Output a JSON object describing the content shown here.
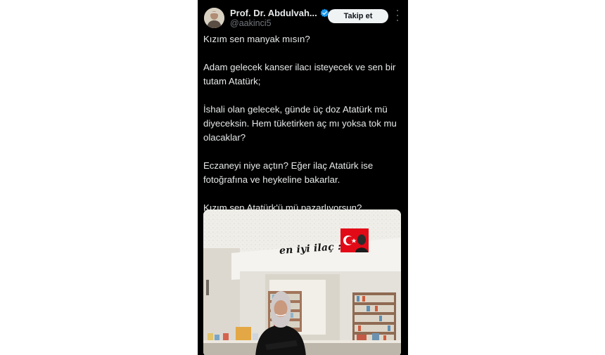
{
  "author": {
    "display_name": "Prof. Dr. Abdulvah...",
    "handle": "@aakinci5",
    "verified_icon": "verified-badge-icon",
    "avatar_icon": "profile-avatar"
  },
  "actions": {
    "follow_label": "Takip et",
    "more_icon": "more-options-icon"
  },
  "tweet": {
    "paragraphs": [
      "Kızım sen manyak mısın?",
      "Adam gelecek kanser ilacı isteyecek ve sen bir tutam Atatürk;",
      "İshali olan gelecek, günde üç doz Atatürk mü diyeceksin. Hem tüketirken aç mı yoksa tok mu olacaklar?",
      "Eczaneyi niye açtın? Eğer ilaç Atatürk ise fotoğrafına ve heykeline bakarlar.",
      "Kızım sen Atatürk'ü mü pazarlıyorsun?"
    ]
  },
  "media": {
    "caption": "en iyi ilaç :",
    "flag_icon": "turkish-flag-icon"
  },
  "colors": {
    "background": "#000000",
    "text": "#e7e9ea",
    "secondary": "#71767b",
    "verified": "#1d9bf0",
    "follow_button_bg": "#eff3f4",
    "flag_red": "#e30a17"
  }
}
